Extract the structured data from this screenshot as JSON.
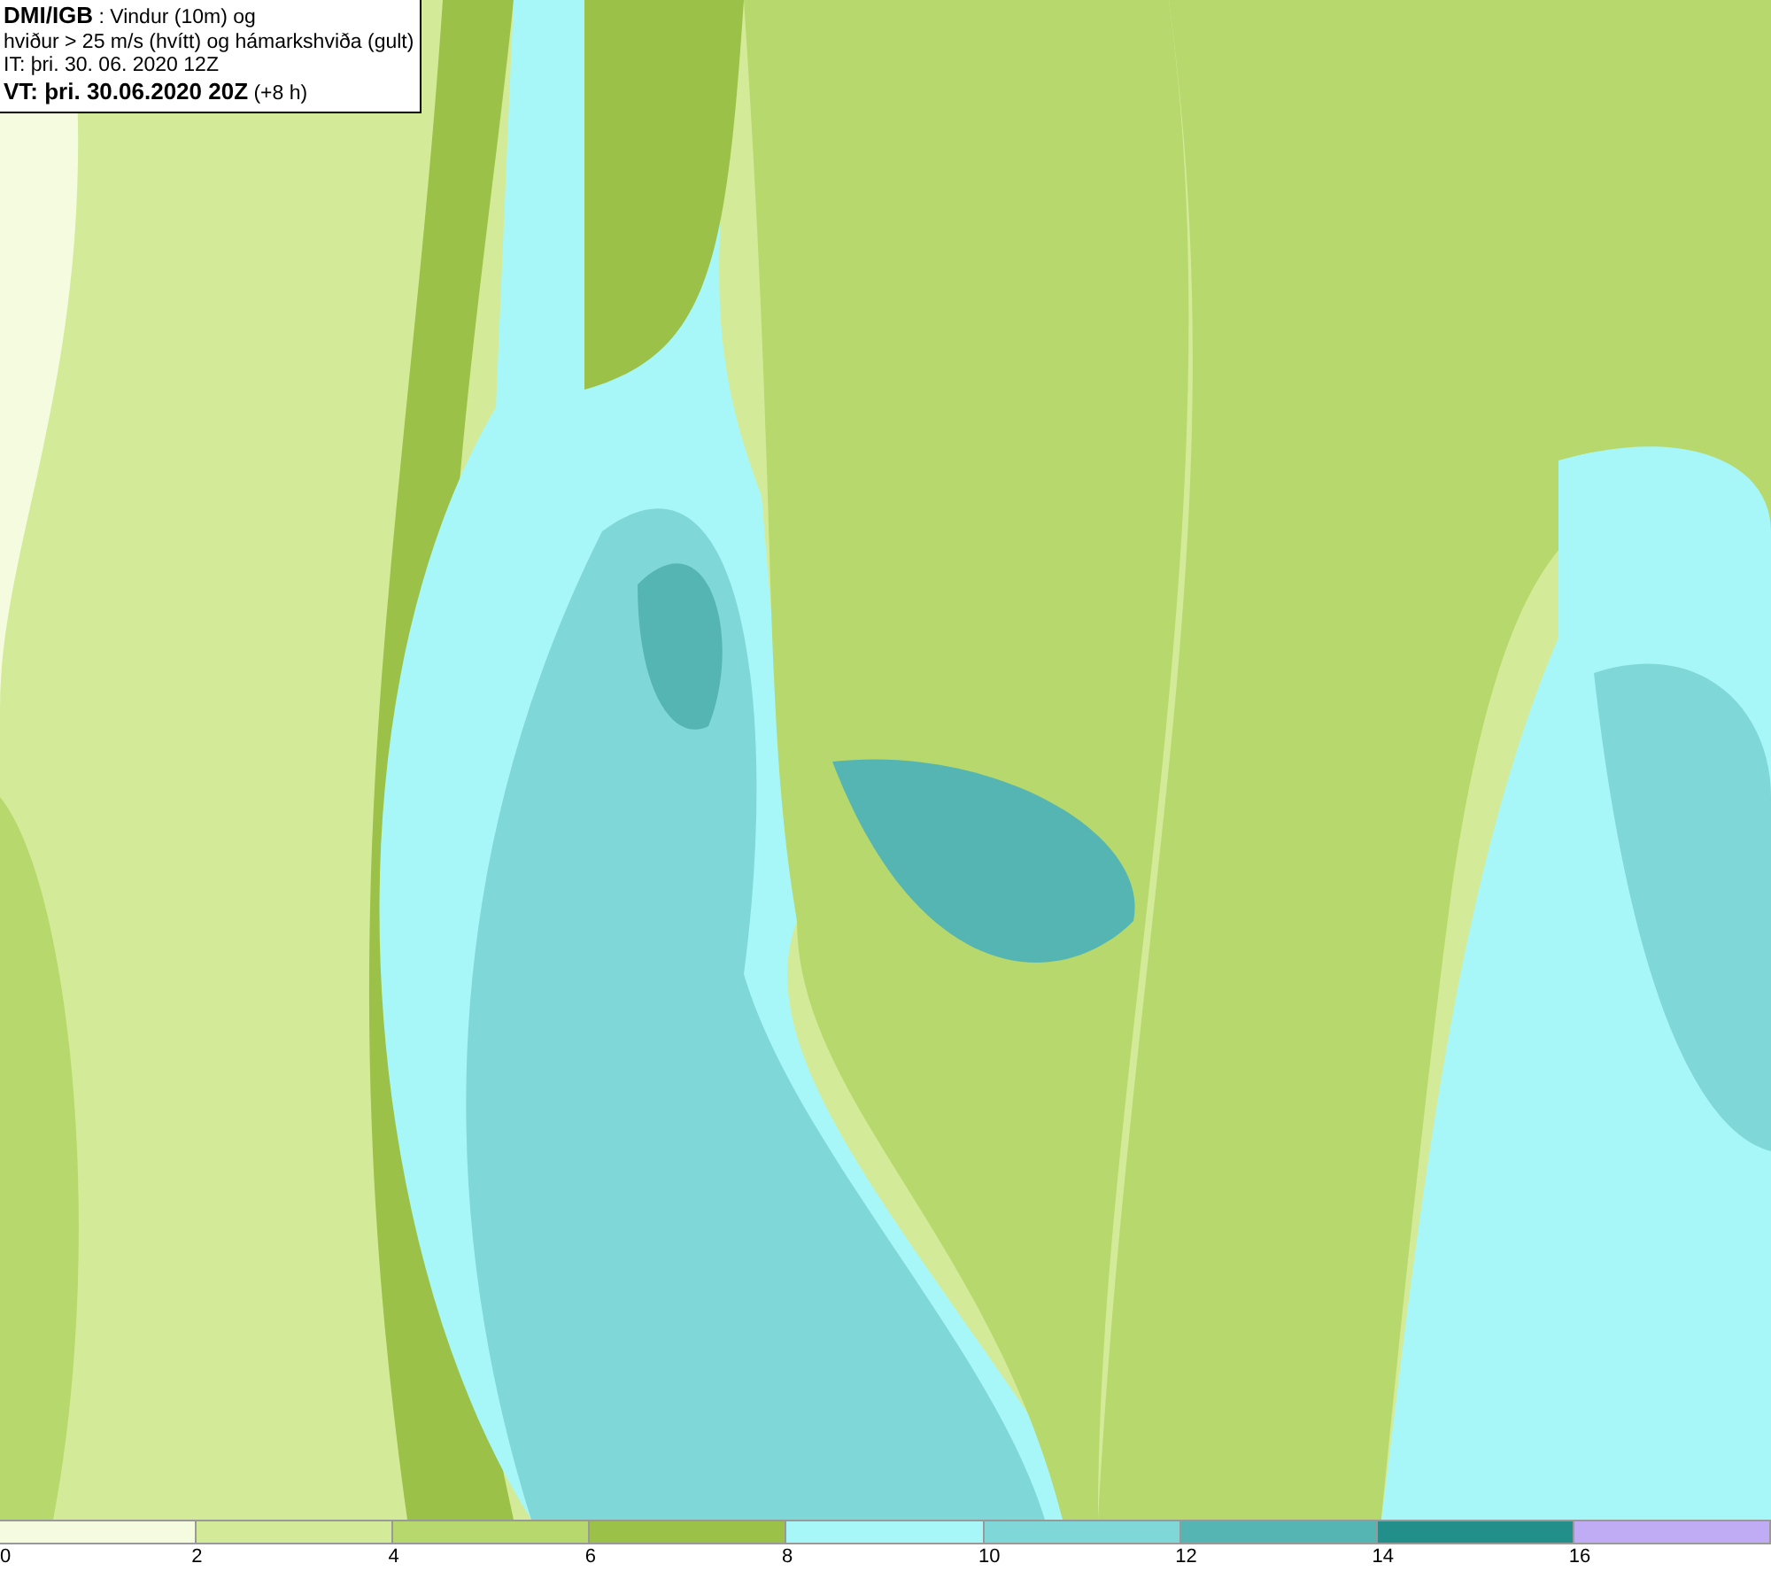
{
  "header": {
    "lines": [
      "**DMI/IGB** : Vindur (10m) og",
      "hviður > 25 m/s (hvítt) og hámarkshviða (gult)",
      "IT: þri. 30. 06. 2020 12Z",
      "**VT: þri. 30.06.2020 20Z** (+8 h)"
    ]
  },
  "legend": [
    {
      "label": "0",
      "color": "#f4fbdf"
    },
    {
      "label": "2",
      "color": "#d3eb98"
    },
    {
      "label": "4",
      "color": "#b7d86c"
    },
    {
      "label": "6",
      "color": "#9cc148"
    },
    {
      "label": "8",
      "color": "#a8f7f8"
    },
    {
      "label": "10",
      "color": "#80d7d8"
    },
    {
      "label": "12",
      "color": "#55b5b3"
    },
    {
      "label": "14",
      "color": "#238f8a"
    },
    {
      "label": "16",
      "color": "#bfacf5"
    }
  ]
}
